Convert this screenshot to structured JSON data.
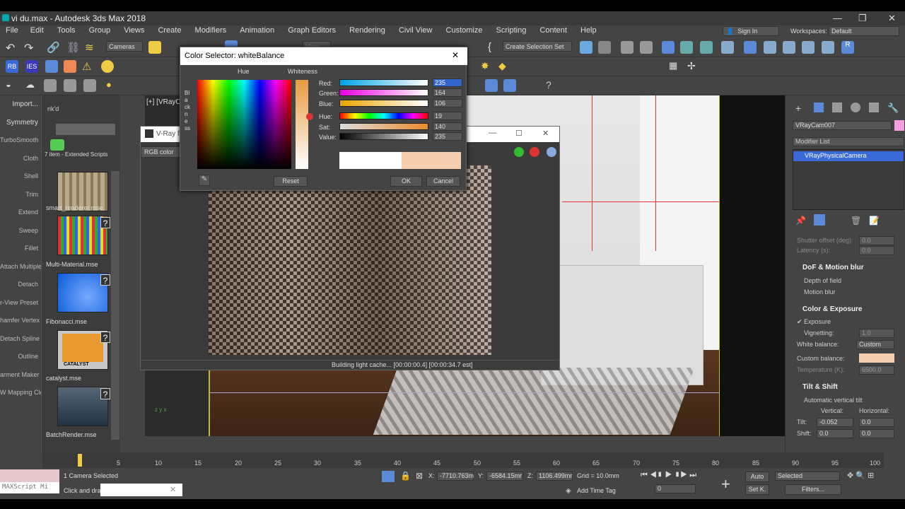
{
  "window": {
    "title": "vi du.max - Autodesk 3ds Max 2018",
    "min": "—",
    "max": "❐",
    "close": "✕"
  },
  "menu": [
    "File",
    "Edit",
    "Tools",
    "Group",
    "Views",
    "Create",
    "Modifiers",
    "Animation",
    "Graph Editors",
    "Rendering",
    "Civil View",
    "Customize",
    "Scripting",
    "Content",
    "Help"
  ],
  "account": {
    "signin": "Sign In",
    "workspaces_label": "Workspaces:",
    "workspace": "Default"
  },
  "toolbar": {
    "viewport_dropdown": "Cameras",
    "view_dropdown": "View",
    "selection_set": "Create Selection Set"
  },
  "toolbar2": {
    "rb": "RB",
    "ies": "IES"
  },
  "command_panel": [
    "Import...",
    "Symmetry",
    "TurboSmooth",
    "Cloth",
    "Shell",
    "Trim",
    "Extend",
    "Sweep",
    "Fillet",
    "Attach Multiple",
    "Detach",
    "r-View Preset",
    "hamfer Vertex",
    "Detach Spline",
    "Outline",
    "arment Maker",
    "W Mapping Cle"
  ],
  "script_panel": {
    "header": "rik'd",
    "count": "7 item - Extended Scripts",
    "items": [
      "smart_renderer.mse",
      "Multi-Material.mse",
      "Fibonacci.mse",
      "catalyst.mse",
      "BatchRender.mse"
    ],
    "catalyst_label": "CATALYST"
  },
  "viewport": {
    "label": "[+] [VRayCa",
    "axis": "z y x"
  },
  "vfb": {
    "title": "V-Ray f",
    "channel": "RGB color",
    "status": "Building light cache... [00:00:00.4] [00:00:34.7 est]"
  },
  "dialog": {
    "title": "Color Selector: whiteBalance",
    "hue_label": "Hue",
    "whiteness_label": "Whiteness",
    "blackness_label": "Blackness",
    "reset": "Reset",
    "ok": "OK",
    "cancel": "Cancel",
    "rows": [
      {
        "label": "Red:",
        "value": "235"
      },
      {
        "label": "Green:",
        "value": "164"
      },
      {
        "label": "Blue:",
        "value": "106"
      },
      {
        "label": "Hue:",
        "value": "19"
      },
      {
        "label": "Sat:",
        "value": "140"
      },
      {
        "label": "Value:",
        "value": "235"
      }
    ],
    "swatch_old": "#ffffff",
    "swatch_new": "#f5cfaf"
  },
  "right_panel": {
    "object_name": "VRayCam007",
    "modifier_list": "Modifier List",
    "modifier": "VRayPhysicalCamera",
    "shutter": "Shutter offset (deg):",
    "shutter_value": "0.0",
    "latency": "Latency (s):",
    "latency_value": "0.0",
    "dof_header": "DoF & Motion blur",
    "dof": "Depth of field",
    "motion_blur": "Motion blur",
    "color_header": "Color & Exposure",
    "exposure": "Exposure",
    "vignetting": "Vignetting:",
    "vignetting_value": "1.0",
    "white_balance": "White balance:",
    "white_balance_value": "Custom",
    "custom_balance": "Custom balance:",
    "temperature": "Temperature (K):",
    "temperature_value": "6500.0",
    "tilt_header": "Tilt & Shift",
    "auto_tilt": "Automatic vertical tilt",
    "vertical": "Vertical:",
    "horizontal": "Horizontal:",
    "tilt": "Tilt:",
    "tilt_v": "-0.052",
    "tilt_h": "0.0",
    "shift": "Shift:",
    "shift_v": "0.0",
    "shift_h": "0.0",
    "custom_balance_color": "#f5cfaf"
  },
  "timeline": {
    "ticks": [
      "5",
      "10",
      "15",
      "20",
      "25",
      "30",
      "35",
      "40",
      "45",
      "50",
      "55",
      "60",
      "65",
      "70",
      "75",
      "80",
      "85",
      "90",
      "95",
      "100"
    ]
  },
  "status": {
    "selected": "1 Camera Selected",
    "hint": "Click and dra",
    "maxscript": "MAXScript Mi",
    "x_label": "X:",
    "x": "-7710.763m",
    "y_label": "Y:",
    "y": "-6584.15mr",
    "z_label": "Z:",
    "z": "1106.499mr",
    "grid": "Grid = 10.0mm",
    "add_time_tag": "Add Time Tag",
    "auto": "Auto",
    "set_key": "Set K.",
    "selected_dd": "Selected",
    "filters": "Filters...",
    "frame": "0"
  }
}
